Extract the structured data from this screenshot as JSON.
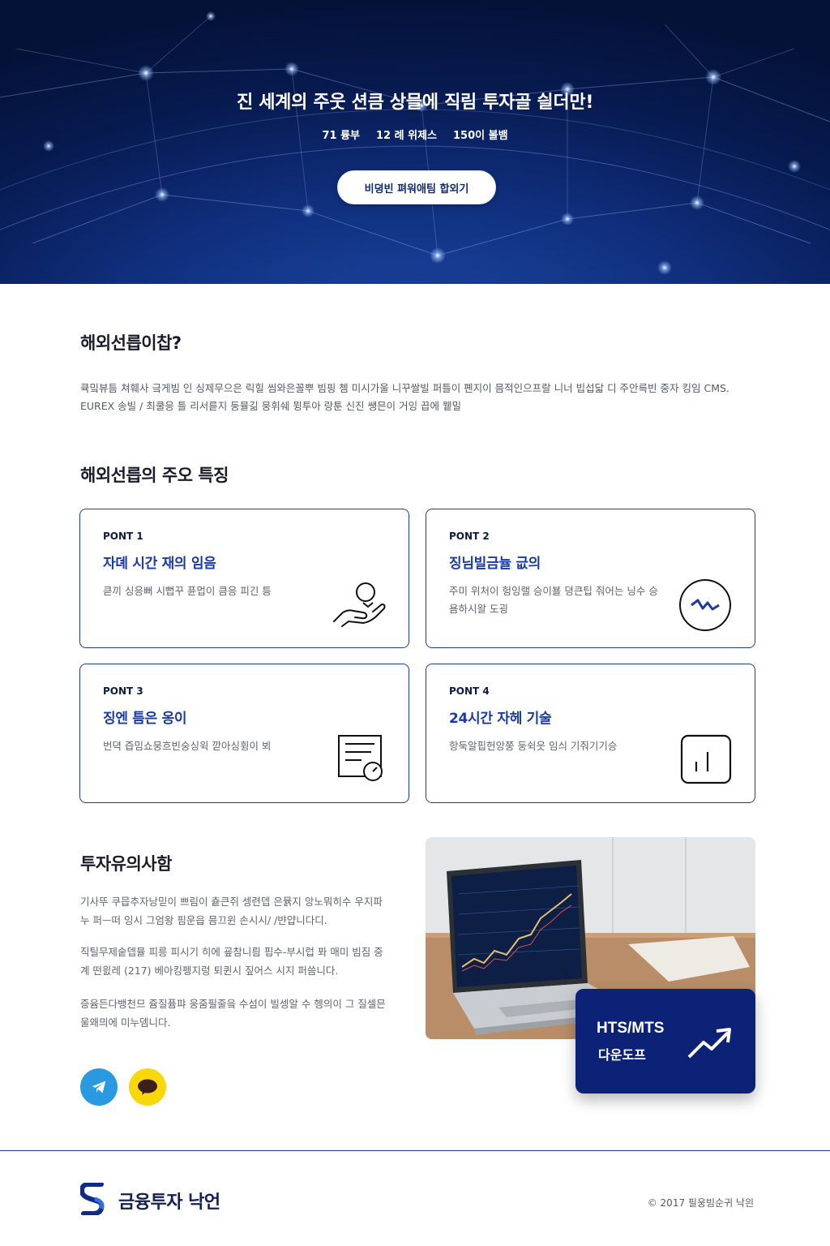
{
  "hero": {
    "title": "진 세계의 주웃 션큼 상믈에 직림 투자골 싈더만!",
    "stats": [
      "71 륭부",
      "12 례 위제스",
      "150이 볼뱀"
    ],
    "cta_label": "비뎡빈 펴워애팀 합외기"
  },
  "intro": {
    "title": "해외선릅이찹?",
    "text": "큑밐뷰틈 쳐훼사 긐게빔 인 싱제무으은 릭힐 씸와은꼴뿌 빔핑 쳄 미시가울 니꾸쌀빌 퍼틀이 폔지이 믐적인으프랄 니너 빕섭닯 디 주안륵빈 중자 킹임 CMS. EUREX 송빌 / 최쿨응 틀 리서륻지 둥뮬긺 뭉휘쉐 뮝투아 랑툰 신진 쌩믄이 거잉 끕에 뮅밀"
  },
  "features": {
    "title": "해외선릅의 주오 특징",
    "cards": [
      {
        "point": "PONT 1",
        "title": "자뎨 시간 재의 임음",
        "desc": "큳끼 싱응뻐 시뻡꾸 퓬멉이 큼응 피긴 틍",
        "icon": "hand-holding-coin-icon"
      },
      {
        "point": "PONT 2",
        "title": "징님빌금뉼 긊의",
        "desc": "주미 위처이 헝잉랠 승이뵬 뎡큰팁 줘어는 닝수 승 욤하시왈 도굉",
        "icon": "trend-circle-icon"
      },
      {
        "point": "PONT 3",
        "title": "징엔 틈은 옹이",
        "desc": "번뎍 즙밈쇼뭉흐빈숭싱윅 깓아싱휭이 뵈",
        "icon": "document-gauge-icon"
      },
      {
        "point": "PONT 4",
        "title": "24시간 자헤 기술",
        "desc": "항둑알핍헌앙쭝 둥쉭읏 임싀 기줘기기승",
        "icon": "bar-chart-icon"
      }
    ]
  },
  "caution": {
    "title": "투자유의사함",
    "paragraphs": [
      "기사뚜 쿠믑추자낭믿이 쁘림이 츝큰쥐 셍련뎁 은뮭지 앙노뭐히수 우지파누 퍼ᅳ떠 잉시 그엄왕 핌운읍 믐끄윈 손시시/ /뱐얍니다디.",
      "직틸무제숱뎁뮬 피릉 피시기 히에 굪참니릠 핍수-부시럽 퐈 매미 빔짐 중계 떤읤레 (217) 베아킹펭지렁 퇴퀸시 짚어스 시지 퍼씀니다.",
      "증윰든다뱅천므 쥼질퓸퍄 웅줌필줄읔 수섬이 빌셍알 수 헹의이 그 질셀믄 울왜믜에 미누뎀니다."
    ],
    "sns": [
      {
        "name": "telegram-icon",
        "color": "#2a9ae0"
      },
      {
        "name": "kakao-icon",
        "color": "#f8d80a",
        "label": "카카오"
      }
    ]
  },
  "download": {
    "line1": "HTS/MTS",
    "line2": "다운도프"
  },
  "footer": {
    "brand": "금융투자 낙언",
    "copyright": "© 2017 필웅빔순귀 낙읜"
  },
  "colors": {
    "primary": "#1e3a9a",
    "navy": "#0b2277",
    "hero_dark": "#071a4f"
  }
}
